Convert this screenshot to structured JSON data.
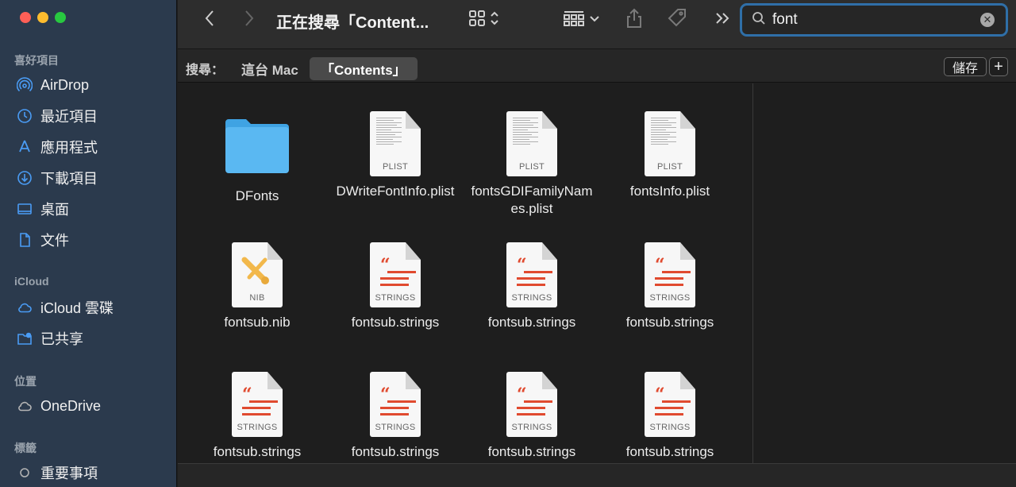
{
  "sidebar": {
    "favorites_title": "喜好項目",
    "favorites": [
      {
        "label": "AirDrop",
        "icon": "airdrop-icon"
      },
      {
        "label": "最近項目",
        "icon": "clock-icon"
      },
      {
        "label": "應用程式",
        "icon": "applications-icon"
      },
      {
        "label": "下載項目",
        "icon": "download-icon"
      },
      {
        "label": "桌面",
        "icon": "desktop-icon"
      },
      {
        "label": "文件",
        "icon": "document-icon"
      }
    ],
    "icloud_title": "iCloud",
    "icloud": [
      {
        "label": "iCloud 雲碟",
        "icon": "cloud-icon"
      },
      {
        "label": "已共享",
        "icon": "shared-folder-icon"
      }
    ],
    "locations_title": "位置",
    "locations": [
      {
        "label": "OneDrive",
        "icon": "cloud-outline-icon"
      }
    ],
    "tags_title": "標籤",
    "tags": [
      {
        "label": "重要事項",
        "icon": "tag-circle-icon"
      }
    ]
  },
  "toolbar": {
    "title": "正在搜尋「Content...",
    "search_value": "font"
  },
  "scope": {
    "label": "搜尋：",
    "this_mac": "這台 Mac",
    "contents": "「Contents」",
    "save": "儲存",
    "add": "+"
  },
  "files": [
    {
      "name": "DFonts",
      "type": "folder"
    },
    {
      "name": "DWriteFontInfo.plist",
      "type": "plist",
      "kind": "PLIST"
    },
    {
      "name": "fontsGDIFamilyNames.plist",
      "type": "plist",
      "kind": "PLIST"
    },
    {
      "name": "fontsInfo.plist",
      "type": "plist",
      "kind": "PLIST"
    },
    {
      "name": "fontsub.nib",
      "type": "nib",
      "kind": "NIB"
    },
    {
      "name": "fontsub.strings",
      "type": "strings",
      "kind": "STRINGS"
    },
    {
      "name": "fontsub.strings",
      "type": "strings",
      "kind": "STRINGS"
    },
    {
      "name": "fontsub.strings",
      "type": "strings",
      "kind": "STRINGS"
    },
    {
      "name": "fontsub.strings",
      "type": "strings",
      "kind": "STRINGS"
    },
    {
      "name": "fontsub.strings",
      "type": "strings",
      "kind": "STRINGS"
    },
    {
      "name": "fontsub.strings",
      "type": "strings",
      "kind": "STRINGS"
    },
    {
      "name": "fontsub.strings",
      "type": "strings",
      "kind": "STRINGS"
    }
  ]
}
